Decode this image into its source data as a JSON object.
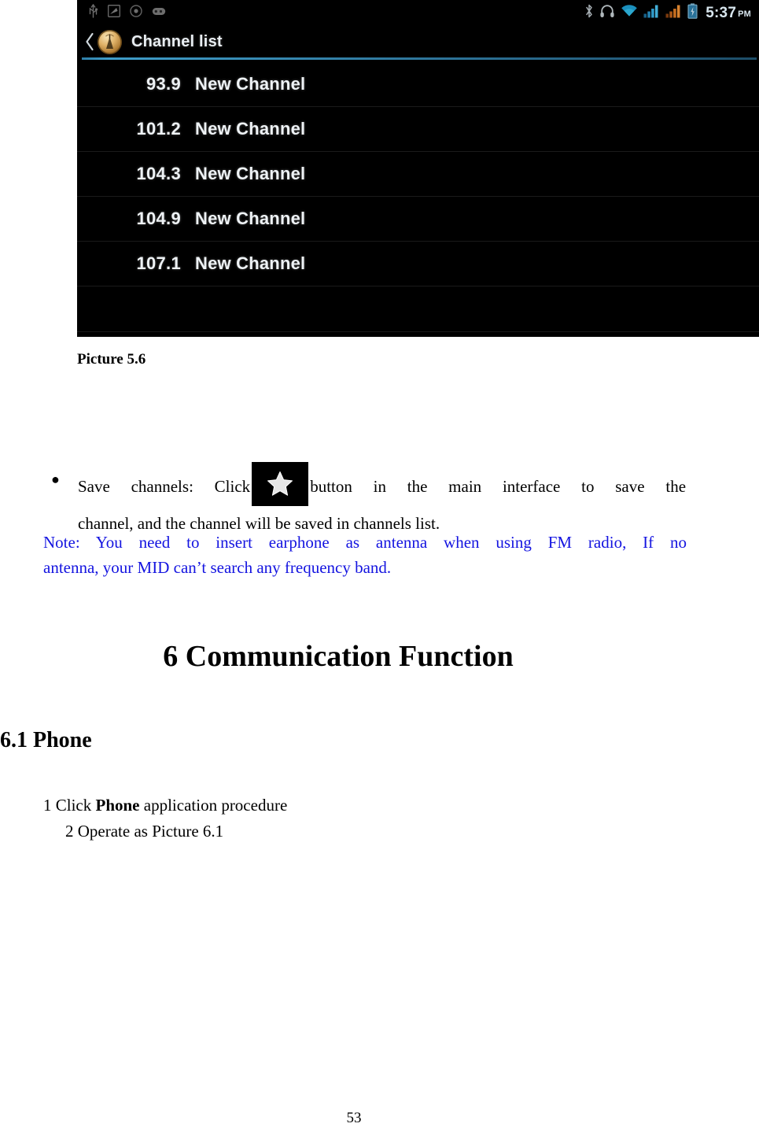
{
  "screenshot": {
    "status_bar": {
      "left_icons": [
        "usb-icon",
        "sd-card-icon",
        "circle-dot-icon",
        "rounded-tag-icon"
      ],
      "right_icons": [
        "bluetooth-icon",
        "headphones-icon",
        "wifi-icon",
        "signal-bars-icon-blue",
        "signal-bars-icon-orange",
        "battery-icon"
      ],
      "time": "5:37",
      "am_pm": "PM"
    },
    "app_bar": {
      "back_icon": "back-chevron-icon",
      "app_icon": "fm-radio-tower-icon",
      "title": "Channel list"
    },
    "channels": [
      {
        "frequency": "93.9",
        "name": "New Channel"
      },
      {
        "frequency": "101.2",
        "name": "New Channel"
      },
      {
        "frequency": "104.3",
        "name": "New Channel"
      },
      {
        "frequency": "104.9",
        "name": "New Channel"
      },
      {
        "frequency": "107.1",
        "name": "New Channel"
      }
    ],
    "colors": {
      "background": "#000000",
      "underline_blue": "#3f9dc9",
      "text": "#eef2f5",
      "app_icon_gold": "#e0b268",
      "signal_blue": "#2f9fd8",
      "signal_orange": "#e8762a"
    }
  },
  "document": {
    "caption": "Picture 5.6",
    "bullet": {
      "dot": "●",
      "text_before_icon": "Save  channels:  Click",
      "icon_name": "star-button-icon",
      "text_after_icon": "button   in   the   main   interface   to   save   the",
      "line2": "channel, and the channel will be saved in channels list."
    },
    "note": {
      "line1": "Note:  You  need  to  insert  earphone  as  antenna  when  using  FM  radio,  If  no",
      "line2": "antenna, your MID can’t search any frequency band.",
      "color": "#1414e0"
    },
    "chapter_heading": "6 Communication Function",
    "section_heading": "6.1 Phone",
    "steps": {
      "step1_prefix": "1 Click ",
      "step1_bold": "Phone",
      "step1_suffix": " application procedure",
      "step2": "2    Operate as Picture 6.1"
    },
    "page_number": "53"
  }
}
